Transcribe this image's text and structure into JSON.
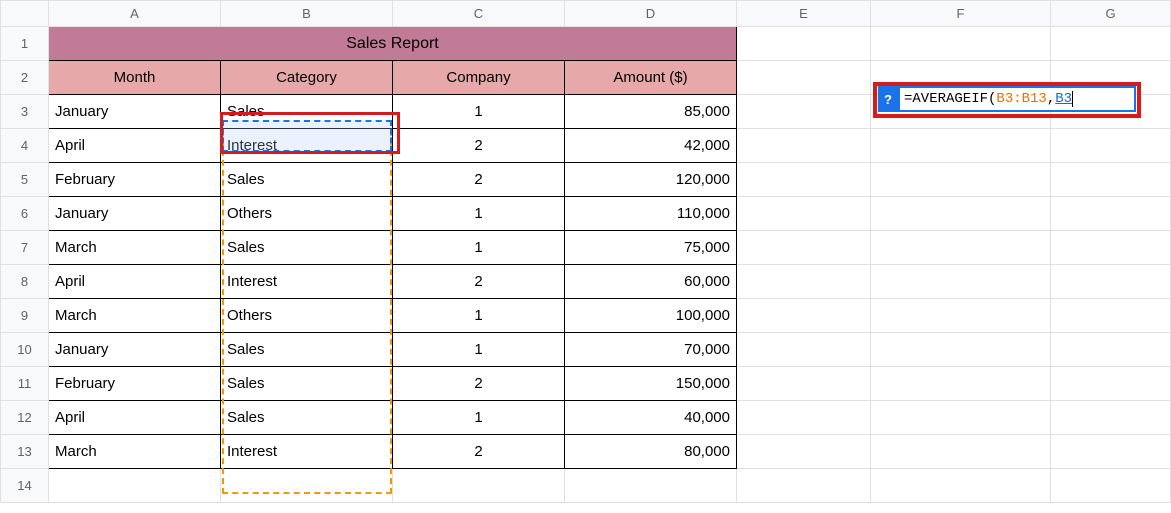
{
  "columns": [
    "A",
    "B",
    "C",
    "D",
    "E",
    "F",
    "G"
  ],
  "row_numbers": [
    "1",
    "2",
    "3",
    "4",
    "5",
    "6",
    "7",
    "8",
    "9",
    "10",
    "11",
    "12",
    "13",
    "14"
  ],
  "title": "Sales Report",
  "headers": {
    "month": "Month",
    "category": "Category",
    "company": "Company",
    "amount": "Amount ($)"
  },
  "rows": [
    {
      "month": "January",
      "category": "Sales",
      "company": "1",
      "amount": "85,000"
    },
    {
      "month": "April",
      "category": "Interest",
      "company": "2",
      "amount": "42,000"
    },
    {
      "month": "February",
      "category": "Sales",
      "company": "2",
      "amount": "120,000"
    },
    {
      "month": "January",
      "category": "Others",
      "company": "1",
      "amount": "110,000"
    },
    {
      "month": "March",
      "category": "Sales",
      "company": "1",
      "amount": "75,000"
    },
    {
      "month": "April",
      "category": "Interest",
      "company": "2",
      "amount": "60,000"
    },
    {
      "month": "March",
      "category": "Others",
      "company": "1",
      "amount": "100,000"
    },
    {
      "month": "January",
      "category": "Sales",
      "company": "1",
      "amount": "70,000"
    },
    {
      "month": "February",
      "category": "Sales",
      "company": "2",
      "amount": "150,000"
    },
    {
      "month": "April",
      "category": "Sales",
      "company": "1",
      "amount": "40,000"
    },
    {
      "month": "March",
      "category": "Interest",
      "company": "2",
      "amount": "80,000"
    }
  ],
  "formula": {
    "help": "?",
    "prefix": "=AVERAGEIF(",
    "range1": "B3:B13",
    "sep": ",",
    "range2": "B3"
  },
  "colors": {
    "title_bg": "#c27b96",
    "header_bg": "#e6a8a8",
    "annot_red": "#d71a1a",
    "range_orange": "#f29900",
    "sel_blue": "#1a73e8"
  }
}
